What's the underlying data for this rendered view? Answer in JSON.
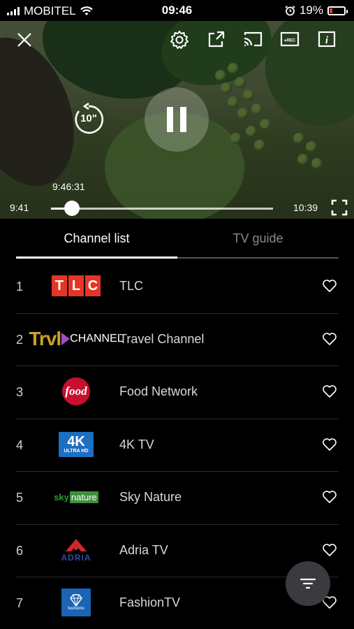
{
  "status_bar": {
    "carrier": "MOBITEL",
    "time": "09:46",
    "battery": "19%"
  },
  "player": {
    "rewind_label": "10\"",
    "tooltip_time": "9:46:31",
    "time_start": "9:41",
    "time_end": "10:39",
    "progress_fraction": 0.09,
    "icons": [
      "close-icon",
      "settings-icon",
      "share-icon",
      "cast-icon",
      "rec-icon",
      "info-icon",
      "rewind-10-icon",
      "pause-icon",
      "fullscreen-icon"
    ]
  },
  "tabs": [
    {
      "label": "Channel list",
      "active": true
    },
    {
      "label": "TV guide",
      "active": false
    }
  ],
  "channels": [
    {
      "number": "1",
      "name": "TLC",
      "logo": "TLC"
    },
    {
      "number": "2",
      "name": "Travel Channel",
      "logo": "Trvl",
      "logo_sub": "CHANNEL"
    },
    {
      "number": "3",
      "name": "Food Network",
      "logo": "food"
    },
    {
      "number": "4",
      "name": "4K TV",
      "logo": "4K",
      "logo_sub": "ULTRA HD"
    },
    {
      "number": "5",
      "name": "Sky Nature",
      "logo": "sky",
      "logo_sub": "nature"
    },
    {
      "number": "6",
      "name": "Adria TV",
      "logo": "ADRIA"
    },
    {
      "number": "7",
      "name": "FashionTV",
      "logo": "fashiontv"
    }
  ],
  "colors": {
    "background": "#000000",
    "tlc_red": "#e53528",
    "trvl_gold": "#c9a227",
    "food_red": "#c8102e",
    "uhd_blue": "#1d6fc1",
    "sky_green": "#2c9c3a",
    "adria_red": "#d22630",
    "adria_blue": "#2b4fa1",
    "ftv_blue": "#1b63b4",
    "battery_red": "#e53935"
  }
}
